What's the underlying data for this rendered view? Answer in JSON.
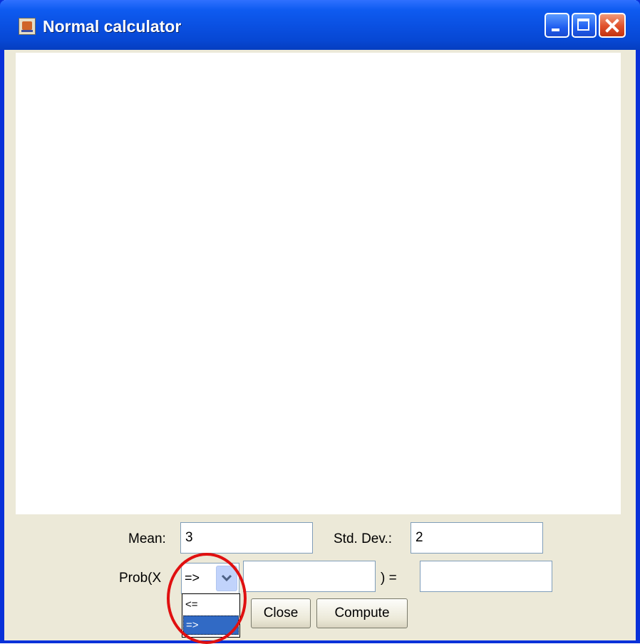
{
  "window": {
    "title": "Normal calculator"
  },
  "form": {
    "mean_label": "Mean:",
    "mean_value": "3",
    "sd_label": "Std. Dev.:",
    "sd_value": "2",
    "prob_label": "Prob(X",
    "equals_label": ") =",
    "x_value": "",
    "result_value": ""
  },
  "comparison": {
    "selected": "=>",
    "options": [
      "<=",
      "=>"
    ],
    "highlighted_option": "=>"
  },
  "buttons": {
    "close": "Close",
    "compute": "Compute"
  },
  "annotation": {
    "circle_color": "#e01010"
  },
  "colors": {
    "titlebar": "#0a4fe0",
    "window_bg": "#ece9d8",
    "selection": "#316ac5"
  }
}
